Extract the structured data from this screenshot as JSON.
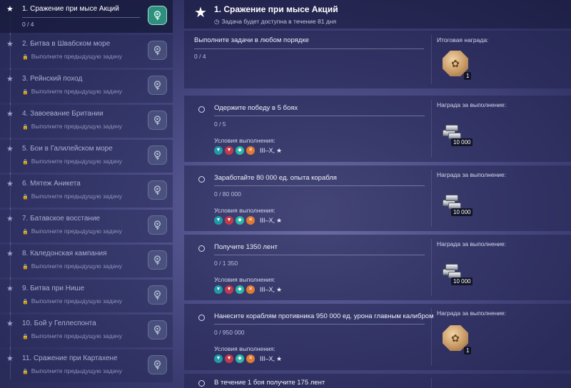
{
  "sidebar": {
    "items": [
      {
        "title": "1. Сражение при мысе Акций",
        "progress": "0 / 4",
        "active": true
      },
      {
        "title": "2. Битва в Швабском море",
        "sub": "Выполните предыдущую задачу"
      },
      {
        "title": "3. Рейнский поход",
        "sub": "Выполните предыдущую задачу"
      },
      {
        "title": "4. Завоевание Британии",
        "sub": "Выполните предыдущую задачу"
      },
      {
        "title": "5. Бои в Галилейском море",
        "sub": "Выполните предыдущую задачу"
      },
      {
        "title": "6. Мятеж Аникета",
        "sub": "Выполните предыдущую задачу"
      },
      {
        "title": "7. Батавское восстание",
        "sub": "Выполните предыдущую задачу"
      },
      {
        "title": "8. Каледонская кампания",
        "sub": "Выполните предыдущую задачу"
      },
      {
        "title": "9. Битва при Нише",
        "sub": "Выполните предыдущую задачу"
      },
      {
        "title": "10. Бой у Геллеспонта",
        "sub": "Выполните предыдущую задачу"
      },
      {
        "title": "11. Сражение при Картахене",
        "sub": "Выполните предыдущую задачу"
      }
    ]
  },
  "header": {
    "title": "1. Сражение при мысе Акций",
    "sub": "Задача будет доступна в течение 81 дня"
  },
  "summary": {
    "title": "Выполните задачи в любом порядке",
    "progress": "0 / 4",
    "reward_label": "Итоговая награда:",
    "reward_qty": "1"
  },
  "tasks": [
    {
      "title": "Одержите победу в 5 боях",
      "progress": "0 / 5",
      "cond_label": "Условия выполнения:",
      "tier": "III–X,",
      "reward_label": "Награда за выполнение:",
      "reward_qty": "10 000",
      "reward_type": "silver"
    },
    {
      "title": "Заработайте 80 000 ед. опыта корабля",
      "progress": "0 / 80 000",
      "cond_label": "Условия выполнения:",
      "tier": "III–X,",
      "reward_label": "Награда за выполнение:",
      "reward_qty": "10 000",
      "reward_type": "silver"
    },
    {
      "title": "Получите 1350 лент",
      "progress": "0 / 1 350",
      "cond_label": "Условия выполнения:",
      "tier": "III–X,",
      "reward_label": "Награда за выполнение:",
      "reward_qty": "10 000",
      "reward_type": "silver"
    },
    {
      "title": "Нанесите кораблям противника 950 000 ед. урона главным калибром",
      "progress": "0 / 950 000",
      "cond_label": "Условия выполнения:",
      "tier": "III–X,",
      "reward_label": "Награда за выполнение:",
      "reward_qty": "1",
      "reward_type": "coin"
    },
    {
      "title": "В течение 1 боя получите 175 лент"
    }
  ],
  "colors": {
    "accent_teal": "#2f8f7f",
    "cond_teal": "#1f9aa6",
    "cond_red": "#c23a4b",
    "cond_cyan": "#2fb4a8",
    "cond_orange": "#e07b33"
  }
}
